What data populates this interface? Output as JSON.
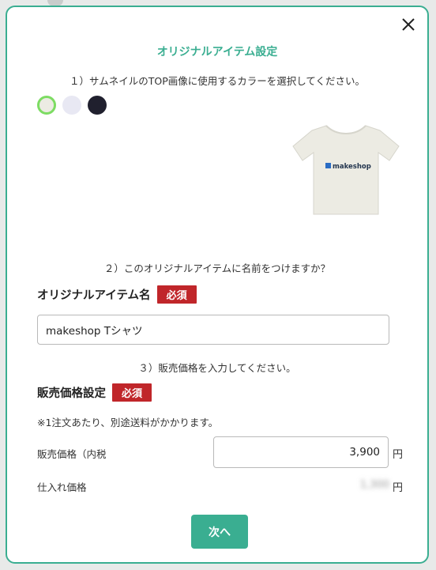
{
  "modal": {
    "title": "オリジナルアイテム設定",
    "close_icon": "close-icon"
  },
  "step1": {
    "text": "１）サムネイルのTOP画像に使用するカラーを選択してください。",
    "swatches": [
      {
        "name": "off-white",
        "color": "#ecebe3",
        "selected": true
      },
      {
        "name": "light-lavender",
        "color": "#e8e8f3",
        "selected": false
      },
      {
        "name": "navy-black",
        "color": "#20202e",
        "selected": false
      }
    ]
  },
  "preview": {
    "logo_text": "makeshop",
    "shirt_color": "#ecebe3"
  },
  "step2": {
    "text": "２）このオリジナルアイテムに名前をつけますか？",
    "label": "オリジナルアイテム名",
    "required": "必須",
    "value": "makeshop Tシャツ"
  },
  "step3": {
    "text": "３）販売価格を入力してください。",
    "label": "販売価格設定",
    "required": "必須",
    "note": "※1注文あたり、別途送料がかかります。",
    "price_label": "販売価格（内税",
    "price_value": "3,900",
    "currency": "円",
    "cost_label": "仕入れ価格",
    "cost_value": "1,300",
    "cost_currency": "円"
  },
  "footer": {
    "next_label": "次へ"
  },
  "colors": {
    "accent": "#3aae91",
    "required": "#c0262a"
  }
}
